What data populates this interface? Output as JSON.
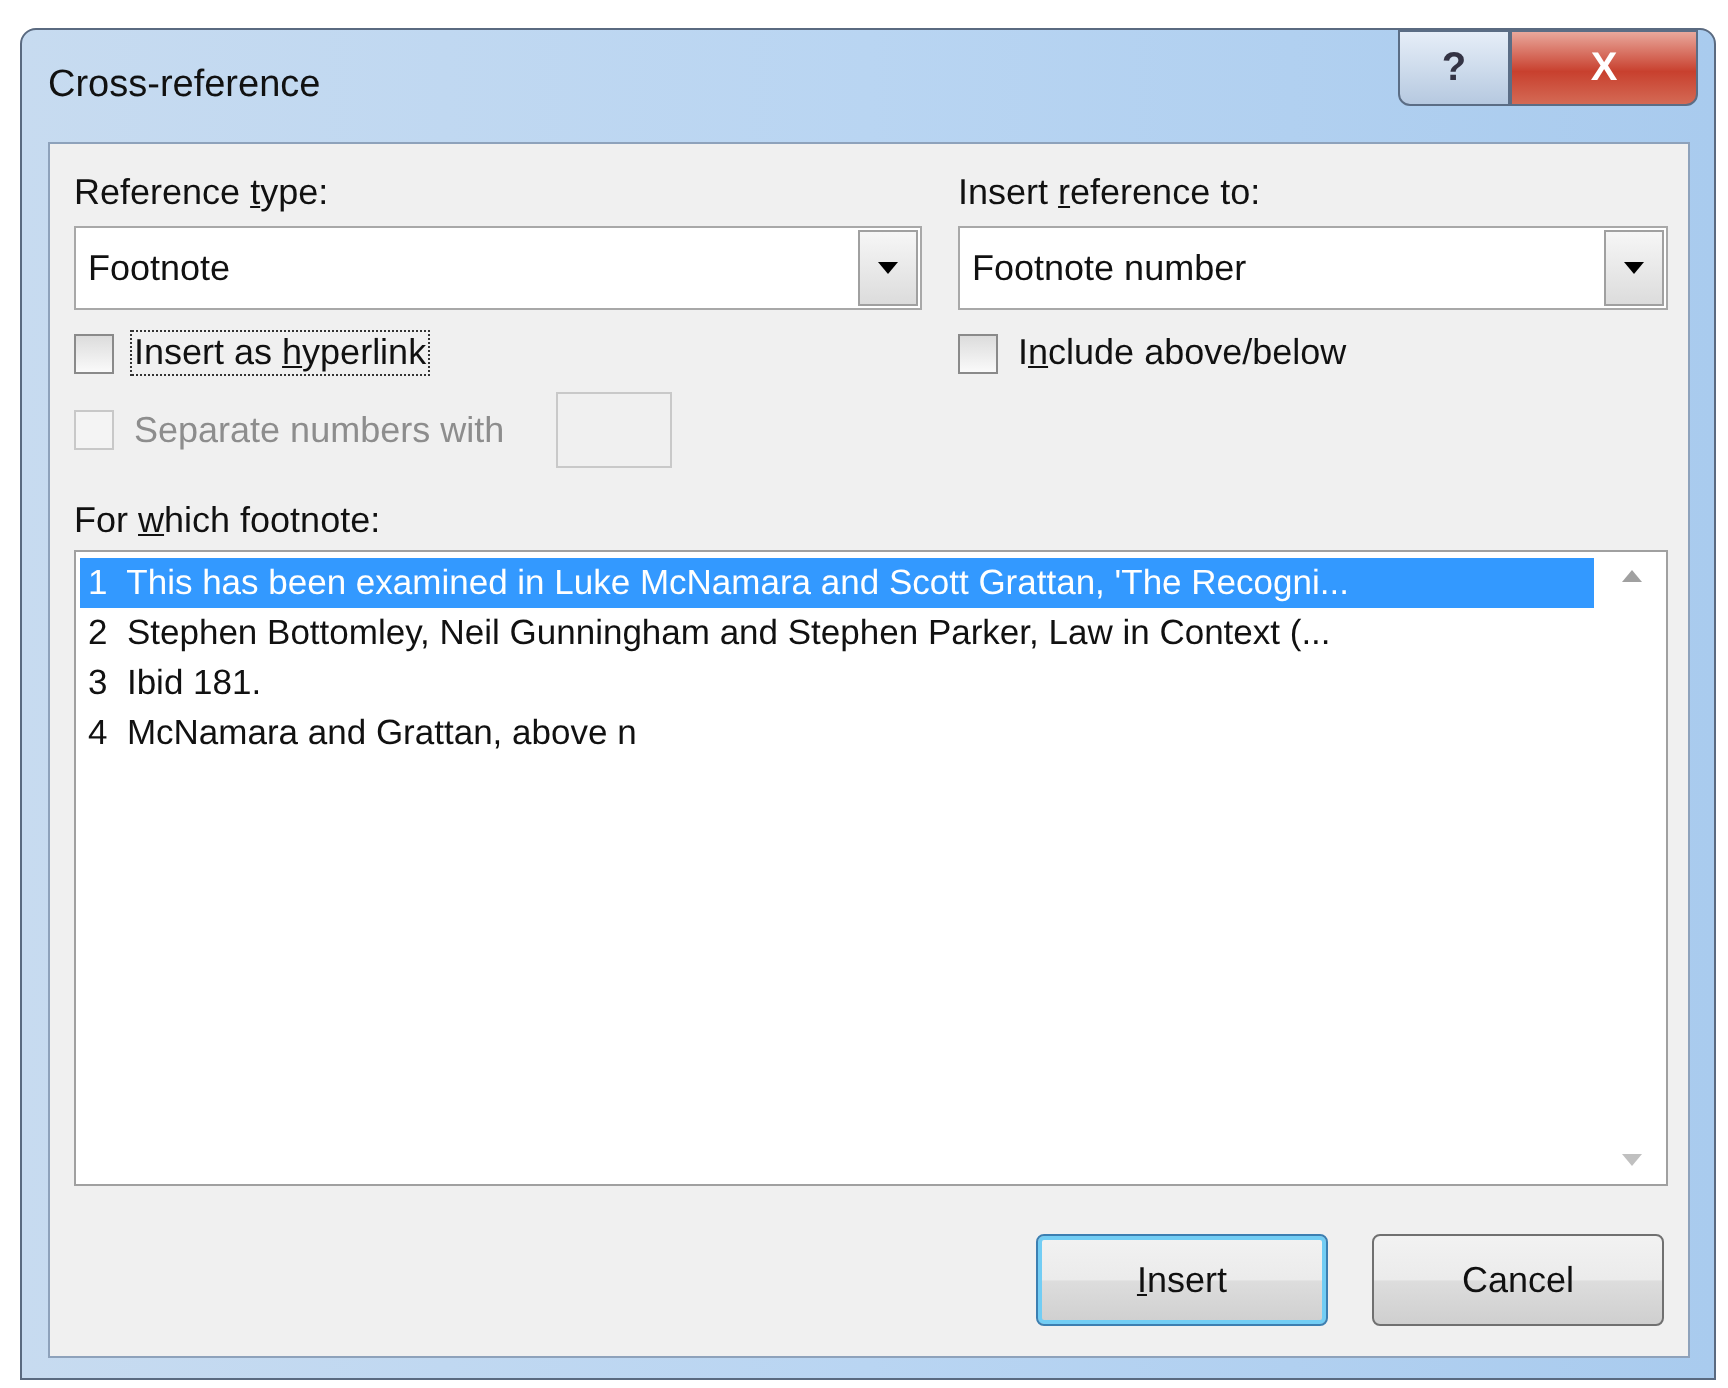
{
  "window": {
    "title": "Cross-reference",
    "help": "?",
    "close": "X"
  },
  "reference_type": {
    "label": [
      "Reference ",
      "t",
      "ype:"
    ],
    "value": "Footnote"
  },
  "insert_reference_to": {
    "label": [
      "Insert ",
      "r",
      "eference to:"
    ],
    "value": "Footnote number"
  },
  "insert_as_hyperlink": {
    "label": [
      "Insert as ",
      "h",
      "yperlink"
    ],
    "checked": false,
    "focused": true
  },
  "include_above_below": {
    "label": [
      "I",
      "n",
      "clude above/below"
    ],
    "checked": false
  },
  "separate_numbers": {
    "label": "Separate numbers with",
    "checked": false,
    "disabled": true
  },
  "footnote_list": {
    "label": [
      "For ",
      "w",
      "hich footnote:"
    ],
    "items": [
      {
        "number": "1",
        "text": "This has been examined in Luke McNamara and Scott Grattan, 'The Recogni...",
        "selected": true
      },
      {
        "number": "2",
        "text": "Stephen Bottomley, Neil Gunningham and Stephen Parker, Law in Context (...",
        "selected": false
      },
      {
        "number": "3",
        "text": "Ibid 181.",
        "selected": false
      },
      {
        "number": "4",
        "text": "McNamara and Grattan, above n",
        "selected": false
      }
    ]
  },
  "buttons": [
    {
      "label": {
        "key": "I",
        "rest": "nsert"
      },
      "default": true
    },
    {
      "label": "Cancel",
      "default": false
    }
  ]
}
